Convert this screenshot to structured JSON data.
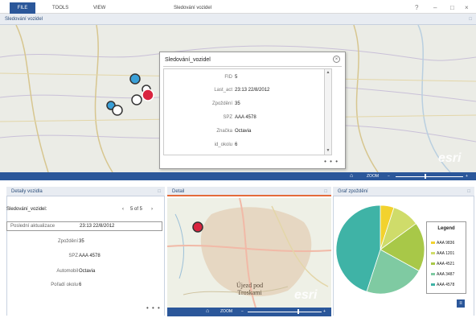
{
  "ribbon": {
    "file_tab": "FILE",
    "tools_tab": "TOOLS",
    "view_tab": "VIEW",
    "window_title": "Sledování vozidel",
    "help": "?",
    "minimize": "–",
    "maximize": "□",
    "close": "×"
  },
  "main_panel": {
    "title": "Sledování vozidel"
  },
  "popup": {
    "title": "Sledování_vozidel",
    "close": "×",
    "rows": [
      {
        "key": "FID",
        "value": "5"
      },
      {
        "key": "Last_act",
        "value": "23:13 22/8/2012"
      },
      {
        "key": "Zpoždění",
        "value": "35"
      },
      {
        "key": "SPZ",
        "value": "AAA 4578"
      },
      {
        "key": "Značka",
        "value": "Octavia"
      },
      {
        "key": "id_okolu",
        "value": "6"
      }
    ],
    "more": "• • •"
  },
  "main_toolbar": {
    "home": "⌂",
    "zoom_label": "ZOOM",
    "minus": "−",
    "plus": "+",
    "esri": "esri"
  },
  "detail_panel": {
    "title": "Detaily vozidla",
    "layer": "Sledování_vozidel:",
    "nav_prev": "‹",
    "nav_text": "5 of 5",
    "nav_next": "›",
    "last_update_label": "Poslední aktualizace",
    "last_update_value": "23:13 22/8/2012",
    "rows": [
      {
        "key": "Zpoždění",
        "value": "35"
      },
      {
        "key": "SPZ",
        "value": "AAA 4578"
      },
      {
        "key": "Automobil",
        "value": "Octavia"
      },
      {
        "key": "Pořadí okolu",
        "value": "6"
      }
    ],
    "more": "• • •"
  },
  "mini_map": {
    "title": "Detail",
    "town_line1": "Újezd pod",
    "town_line2": "Troskami",
    "home": "⌂",
    "zoom_label": "ZOOM",
    "minus": "−",
    "plus": "+",
    "esri": "esri"
  },
  "chart_panel": {
    "title": "Graf zpoždění",
    "corner_icon": "≡",
    "pin": "□"
  },
  "chart_data": {
    "type": "pie",
    "legend_title": "Legend",
    "legend_position": "right",
    "categories": [
      "AAA 9836",
      "AAA 1201",
      "AAA 4521",
      "AAA 3487",
      "AAA 4578"
    ],
    "values": [
      5,
      10,
      18,
      22,
      45
    ],
    "colors": [
      "#f2d22e",
      "#cfdc6a",
      "#a8c848",
      "#7fcaa2",
      "#3fb3a6"
    ]
  },
  "colors": {
    "accent": "#2b579a",
    "marker_blue": "#3aa0d8",
    "marker_red": "#d9243f"
  }
}
